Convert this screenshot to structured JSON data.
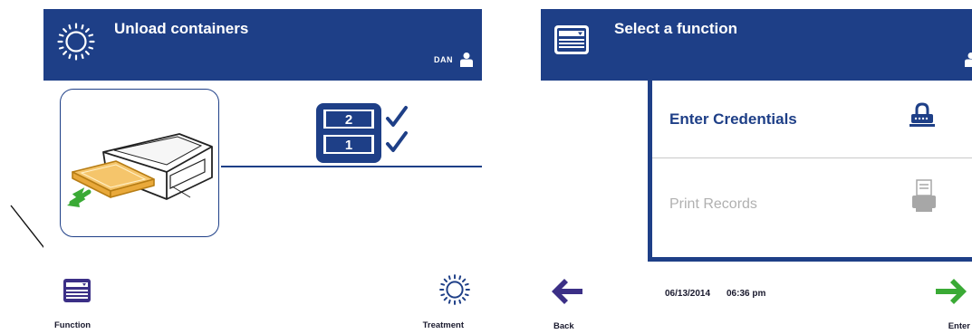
{
  "left_screen": {
    "header": {
      "title": "Unload containers",
      "user": "DAN",
      "icon": "treatment-sun-icon"
    },
    "status": {
      "rack_top": "2",
      "rack_bottom": "1"
    },
    "bottom": {
      "function_label": "Function",
      "treatment_label": "Treatment"
    }
  },
  "right_screen": {
    "header": {
      "title": "Select a function",
      "icon": "function-menu-icon"
    },
    "menu": [
      {
        "label": "Enter Credentials",
        "icon": "lock-icon",
        "enabled": true
      },
      {
        "label": "Print Records",
        "icon": "printer-icon",
        "enabled": false
      }
    ],
    "footer": {
      "date": "06/13/2014",
      "time": "06:36 pm",
      "back_label": "Back",
      "enter_label": "Enter"
    }
  },
  "colors": {
    "header": "#1e3f87",
    "accent_green": "#3aaa35",
    "nav_blue": "#3b2f86",
    "disabled_text": "#b0b0b0"
  }
}
